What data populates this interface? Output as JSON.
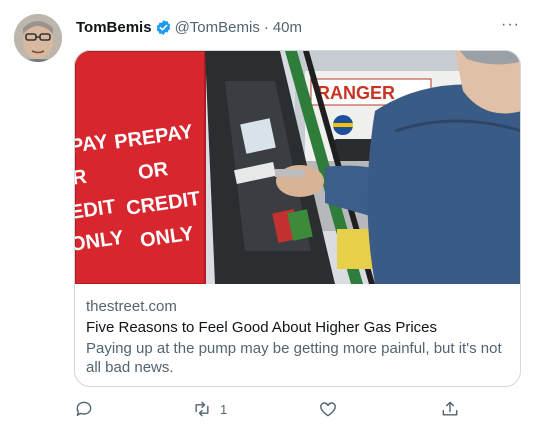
{
  "author": {
    "display_name": "TomBemis",
    "handle": "@TomBemis",
    "separator": "·",
    "time": "40m",
    "verified": true
  },
  "more_label": "···",
  "card": {
    "domain": "thestreet.com",
    "title": "Five Reasons to Feel Good About Higher Gas Prices",
    "description": "Paying up at the pump may be getting more painful, but it's not all bad news.",
    "image": {
      "pump_sign_left": [
        "PAY",
        "R",
        "EDIT",
        "ONLY"
      ],
      "pump_sign_right": [
        "PREPAY",
        "OR",
        "CREDIT",
        "ONLY"
      ],
      "store_sign": "RANGER"
    }
  },
  "actions": {
    "reply_count": "",
    "retweet_count": "1",
    "like_count": "",
    "share_count": ""
  },
  "colors": {
    "verified": "#1d9bf0",
    "text_primary": "#0f1419",
    "text_secondary": "#536471",
    "border": "#cfd9de",
    "pump_red": "#d8262e"
  }
}
